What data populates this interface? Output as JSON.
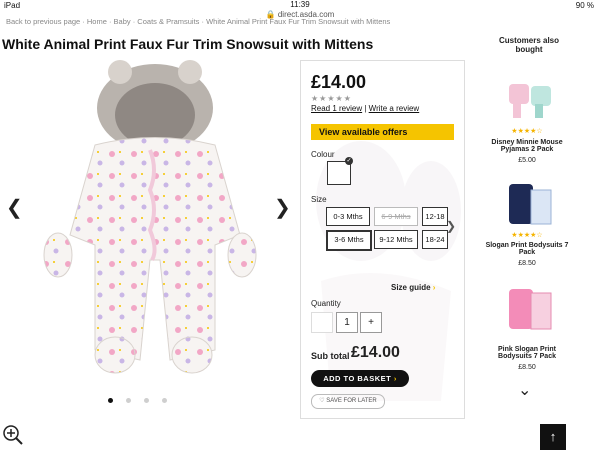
{
  "status": {
    "device": "iPad",
    "time": "11:39",
    "battery": "90 %"
  },
  "browser": {
    "url": "direct.asda.com"
  },
  "breadcrumb": "Back to previous page   ·   Home · Baby · Coats & Pramsuits · White Animal Print Faux Fur Trim Snowsuit with Mittens",
  "product": {
    "title": "White Animal Print Faux Fur Trim Snowsuit with Mittens",
    "price": "£14.00",
    "rating_stars": "★★★★★",
    "read_review": "Read 1 review",
    "review_sep": " | ",
    "write_review": "Write a review",
    "offers_label": "View available offers",
    "colour_label": "Colour",
    "size_label": "Size",
    "sizes": [
      {
        "label": "0-3 Mths",
        "state": "available"
      },
      {
        "label": "6-9 Mths",
        "state": "unavailable"
      },
      {
        "label": "12-18",
        "state": "available"
      },
      {
        "label": "3-6 Mths",
        "state": "selected"
      },
      {
        "label": "9-12 Mths",
        "state": "available"
      },
      {
        "label": "18-24",
        "state": "available"
      }
    ],
    "size_guide": "Size guide",
    "quantity_label": "Quantity",
    "quantity_value": "1",
    "plus": "+",
    "subtotal_label": "Sub total",
    "subtotal_value": "£14.00",
    "add_to_basket": "ADD TO BASKET",
    "save_for_later": "SAVE FOR LATER"
  },
  "carousel": {
    "dots": 4,
    "active_index": 0
  },
  "also_bought": {
    "heading": "Customers also bought",
    "items": [
      {
        "name": "Disney Minnie Mouse Pyjamas 2 Pack",
        "price": "£5.00",
        "stars": "★★★★☆"
      },
      {
        "name": "Slogan Print Bodysuits 7 Pack",
        "price": "£8.50",
        "stars": "★★★★☆"
      },
      {
        "name": "Pink Slogan Print Bodysuits 7 Pack",
        "price": "£8.50",
        "stars": ""
      }
    ]
  },
  "icons": {
    "prev": "chevron-left-icon",
    "next": "chevron-right-icon",
    "down": "chevron-down-icon",
    "zoom": "zoom-in-icon",
    "top": "scroll-top-icon"
  },
  "colors": {
    "accent_yellow": "#f5c400",
    "dark": "#111111"
  }
}
